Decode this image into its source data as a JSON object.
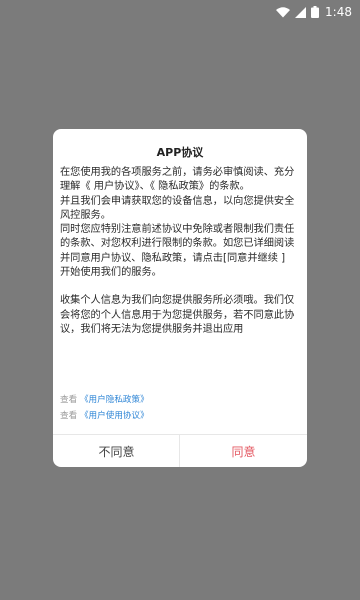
{
  "status_bar": {
    "time": "1:48",
    "icons": [
      "wifi-icon",
      "signal-icon",
      "battery-icon"
    ],
    "color": "#ffffff"
  },
  "dialog": {
    "title": "APP协议",
    "paragraphs": [
      "在您使用我的各项服务之前，请务必审慎阅读、充分理解《 用户协议》、《 隐私政策》的条款。",
      "并且我们会申请获取您的设备信息，以向您提供安全风控服务。",
      "同时您应特别注意前述协议中免除或者限制我们责任的条款、对您权利进行限制的条款。如您已详细阅读并同意用户协议、隐私政策，请点击[同意并继续 ] 开始使用我们的服务。",
      "",
      "收集个人信息为我们向您提供服务所必须哦。我们仅会将您的个人信息用于为您提供服务，若不同意此协议，我们将无法为您提供服务并退出应用"
    ],
    "links": [
      {
        "prefix": "查看",
        "label": "《用户隐私政策》"
      },
      {
        "prefix": "查看",
        "label": "《用户使用协议》"
      }
    ],
    "disagree_label": "不同意",
    "agree_label": "同意",
    "accent_color": "#e45862",
    "link_color": "#2f86d6"
  }
}
